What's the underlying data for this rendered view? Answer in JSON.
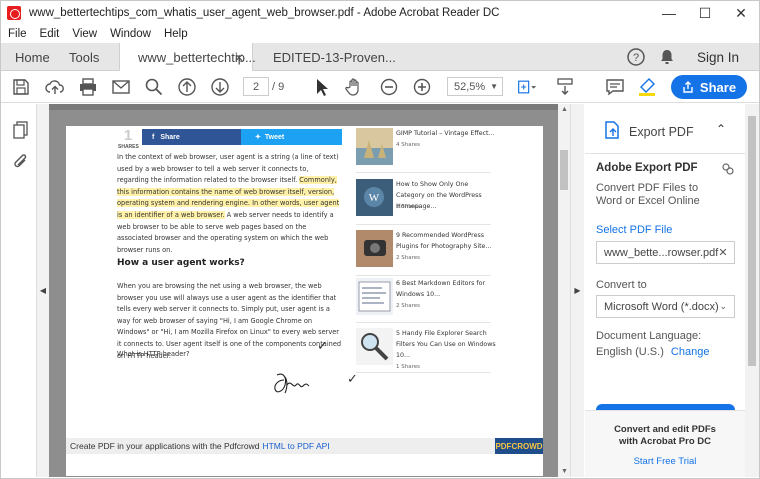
{
  "window": {
    "title": "www_bettertechtips_com_whatis_user_agent_web_browser.pdf - Adobe Acrobat Reader DC",
    "minimize": "—",
    "maximize": "☐",
    "close": "✕"
  },
  "menu": [
    "File",
    "Edit",
    "View",
    "Window",
    "Help"
  ],
  "tabs": {
    "home": "Home",
    "tools": "Tools",
    "doc1": "www_bettertechtip...",
    "doc1_close": "✕",
    "doc2": "EDITED-13-Proven..."
  },
  "header_right": {
    "sign_in": "Sign In"
  },
  "toolbar": {
    "page_current": "2",
    "page_total": "/  9",
    "zoom": "52,5%",
    "share_label": "Share"
  },
  "document": {
    "share_count": "1",
    "share_count_label": "SHARES",
    "facebook_label": "Share",
    "twitter_label": "Tweet",
    "para1_plain_a": "In the context of web browser, user agent is a string (a line of text) used by a web browser to tell a web server it connects to, regarding the information related to the browser itself. ",
    "para1_hl": "Commonly, this information contains the name of web browser itself, version, operating system and rendering engine. In other words, user agent is an identifier of a web browser.",
    "para1_plain_b": " A web server needs to identify a web browser to be able to serve web pages based on the associated browser and the operating system on which the web browser runs on.",
    "heading": "How a user agent works?",
    "para2": "When you are browsing the net using a web browser, the web browser you use will always use a user agent as the identifier that tells every web server it connects to. Simply put, user agent is a way for web browser of saying \"Hi, I am Google Chrome on Windows\" or \"Hi, I am Mozilla Firefox on Linux\" to every web server it connects to. User agent itself is one of the components contained on HTTP header.",
    "para3": "What is HTTP header?",
    "checkmark": "✓",
    "related": [
      {
        "title": "GIMP Tutorial – Vintage Effect...",
        "shares": "4 Shares"
      },
      {
        "title": "How to Show Only One Category on the WordPress Homepage...",
        "shares": "2 Shares"
      },
      {
        "title": "9 Recommended WordPress Plugins for Photography Site...",
        "shares": "2 Shares"
      },
      {
        "title": "6 Best Markdown Editors for Windows 10...",
        "shares": "2 Shares"
      },
      {
        "title": "5 Handy File Explorer Search Filters You Can Use on Windows 10...",
        "shares": "1 Shares"
      }
    ],
    "footer_text": "Create PDF in your applications with the Pdfcrowd",
    "footer_link": "HTML to PDF API",
    "footer_badge": "PDFCROWD"
  },
  "right_panel": {
    "title": "Export PDF",
    "subtitle": "Adobe Export PDF",
    "description": "Convert PDF Files to Word or Excel Online",
    "select_label": "Select PDF File",
    "file_name": "www_bette...rowser.pdf",
    "convert_label": "Convert to",
    "convert_value": "Microsoft Word (*.docx)",
    "language_label": "Document Language:",
    "language_value": "English (U.S.)",
    "change_link": "Change",
    "promo": "Convert and edit PDFs with Acrobat Pro DC",
    "trial_link": "Start Free Trial"
  },
  "colors": {
    "accent": "#1473e6",
    "facebook": "#2f5597",
    "twitter": "#1da1f2",
    "highlight": "#fff1a8"
  }
}
